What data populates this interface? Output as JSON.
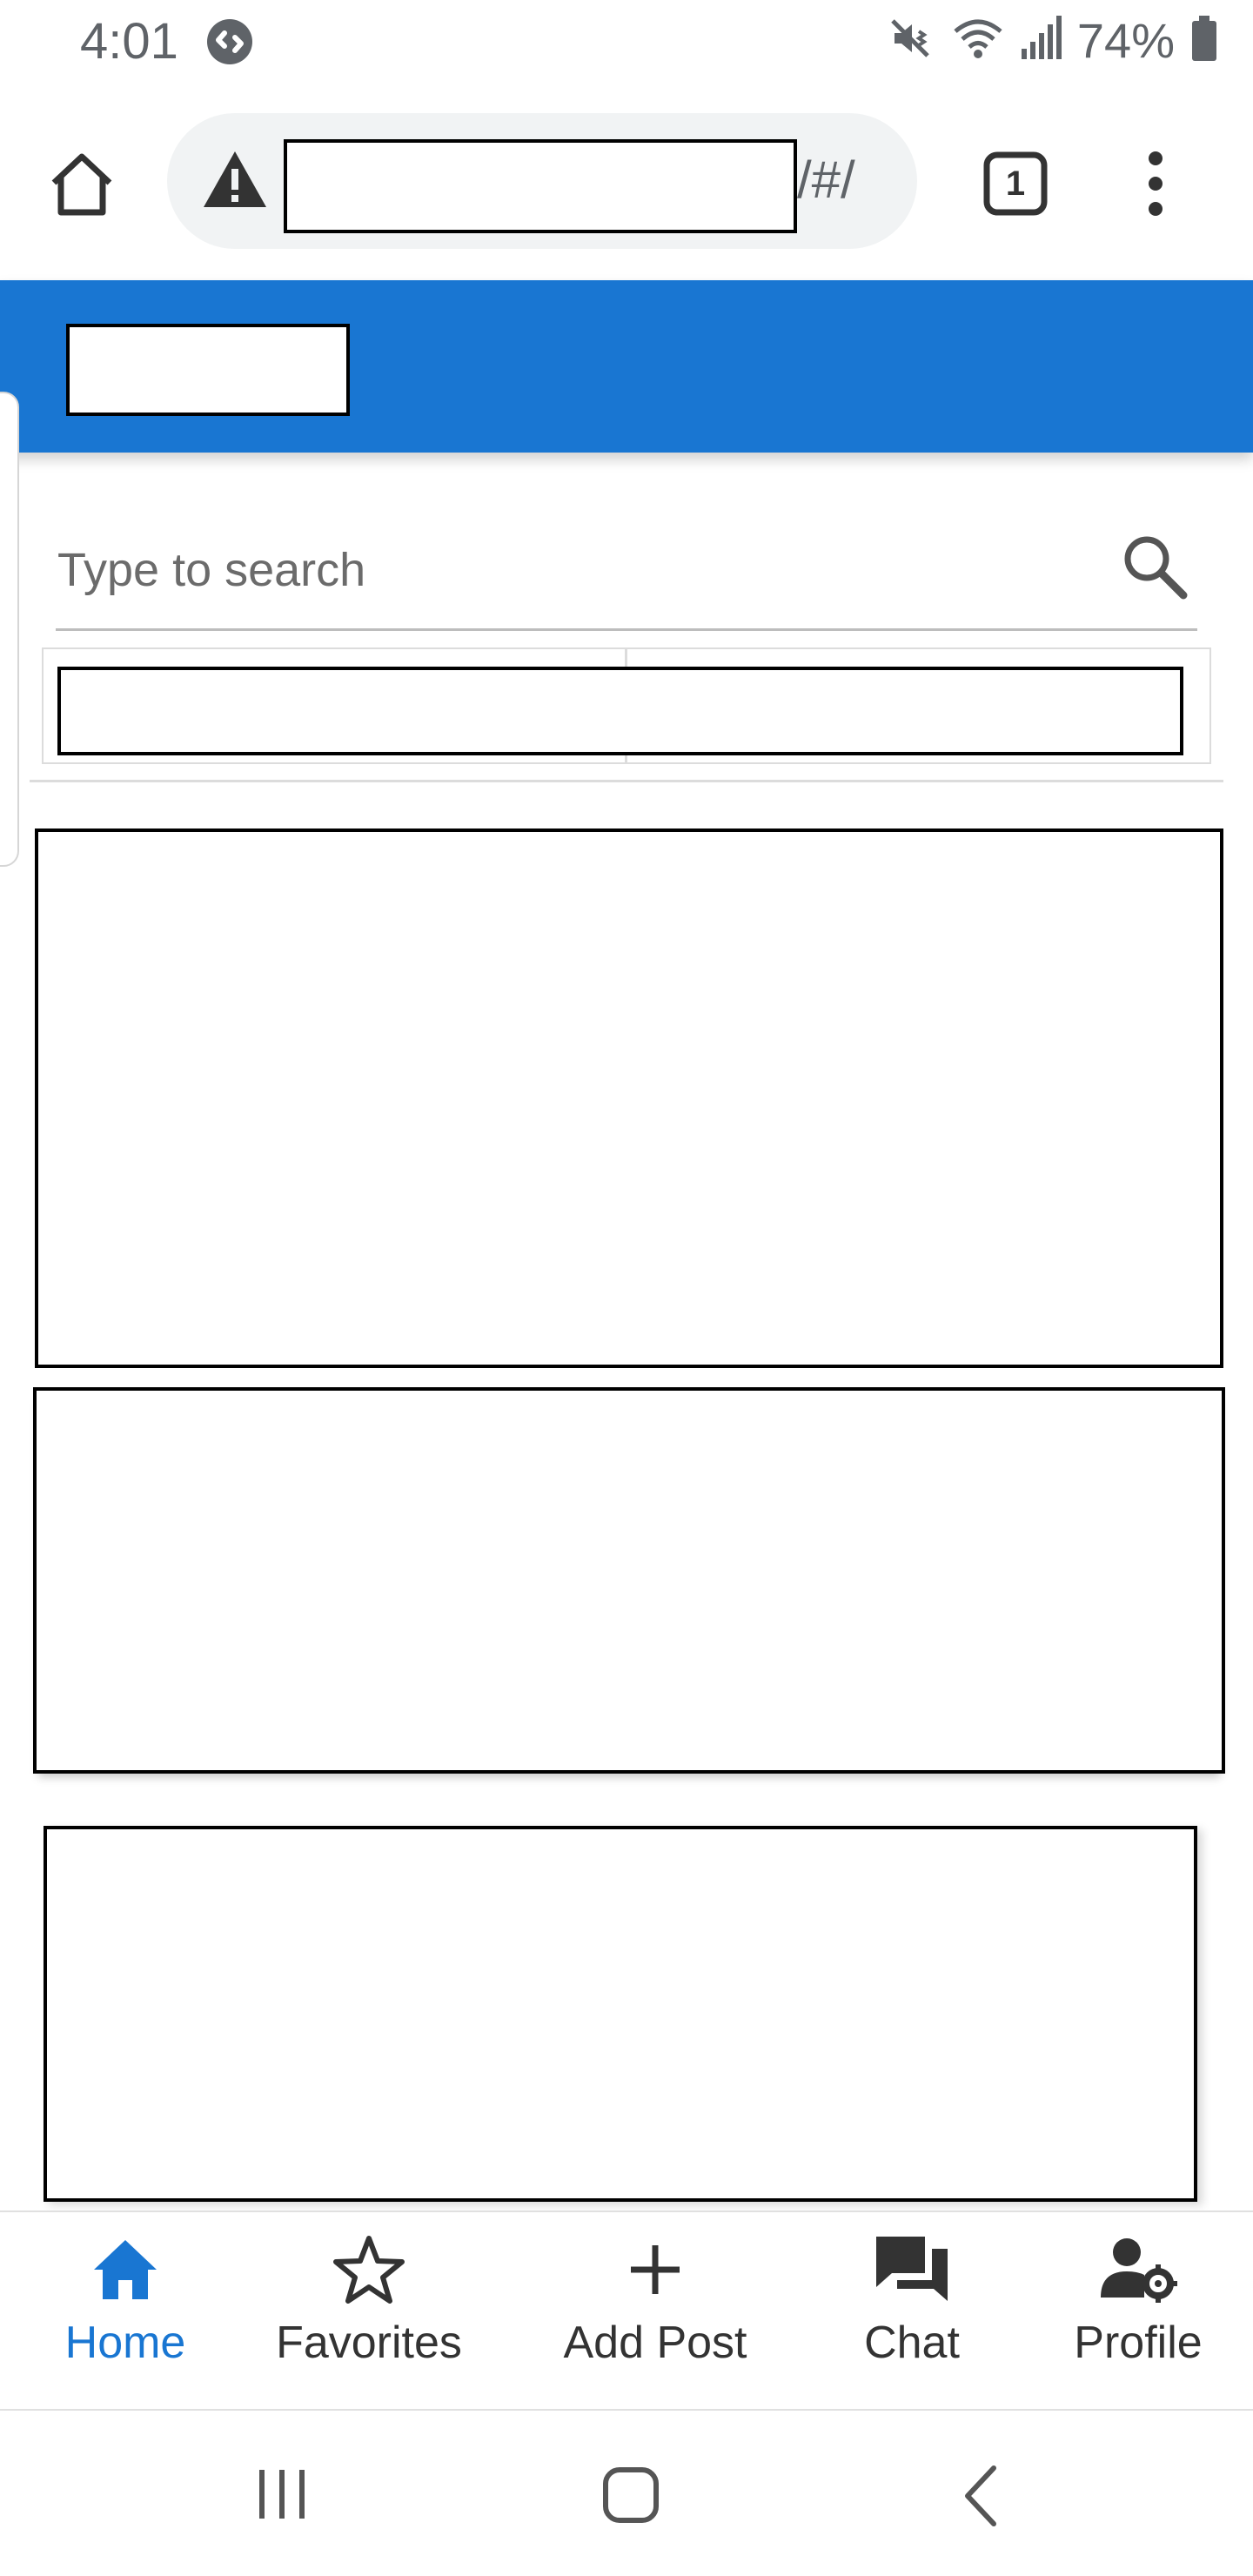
{
  "status_bar": {
    "time": "4:01",
    "battery_percent": "74%",
    "icons": [
      "shazam-icon",
      "mute-vibrate-icon",
      "wifi-icon",
      "signal-icon",
      "battery-icon"
    ]
  },
  "browser": {
    "url_suffix": "/#/",
    "tab_count": "1",
    "icons": [
      "home-icon",
      "warning-icon",
      "tabs-icon",
      "more-vert-icon"
    ]
  },
  "search": {
    "placeholder": "Type to search",
    "value": ""
  },
  "bottom_nav": {
    "items": [
      {
        "label": "Home",
        "icon": "home-icon",
        "active": true
      },
      {
        "label": "Favorites",
        "icon": "star-outline-icon",
        "active": false
      },
      {
        "label": "Add Post",
        "icon": "plus-icon",
        "active": false
      },
      {
        "label": "Chat",
        "icon": "chat-icon",
        "active": false
      },
      {
        "label": "Profile",
        "icon": "manage-account-icon",
        "active": false
      }
    ]
  },
  "colors": {
    "primary": "#1976d2",
    "nav_inactive": "#333333",
    "status_text": "#5f6368"
  }
}
